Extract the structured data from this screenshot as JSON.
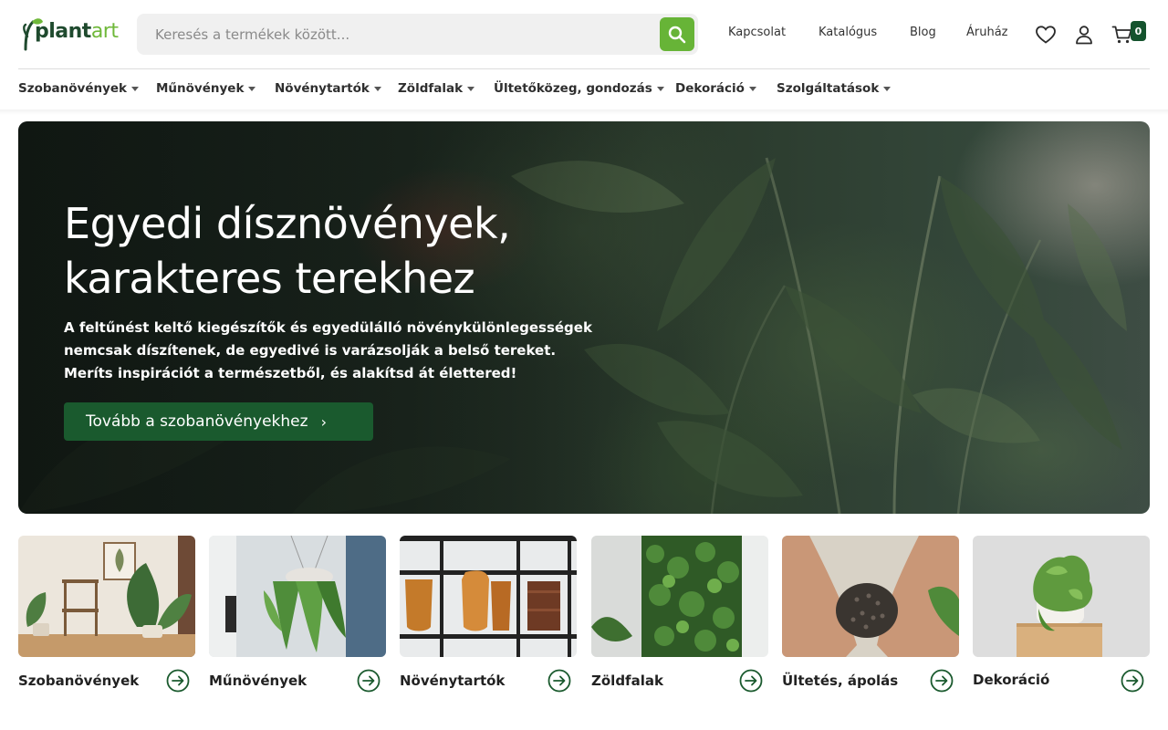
{
  "brand": {
    "logo_first": "plant",
    "logo_second": "art",
    "green": "#67b437",
    "dark_green": "#1a5a2e"
  },
  "search": {
    "placeholder": "Keresés a termékek között...",
    "value": ""
  },
  "header_links": [
    "Kapcsolat",
    "Katalógus",
    "Blog",
    "Áruház"
  ],
  "header_icons": {
    "wishlist": "heart-icon",
    "account": "user-icon",
    "cart": "cart-icon"
  },
  "cart": {
    "count": "0"
  },
  "category_nav": [
    "Szobanövények",
    "Műnövények",
    "Növénytartók",
    "Zöldfalak",
    "Ültetőközeg, gondozás",
    "Dekoráció",
    "Szolgáltatások"
  ],
  "hero": {
    "title_line1": "Egyedi dísznövények,",
    "title_line2": "karakteres terekhez",
    "text_line1": "A feltűnést keltő kiegészítők és egyedülálló növénykülönlegességek",
    "text_line2": "nemcsak díszítenek, de egyedivé is varázsolják a belső tereket.",
    "text_line3": "Meríts inspirációt a természetből, és alakítsd át élettered!",
    "cta": "Tovább a szobanövényekhez"
  },
  "cards": [
    {
      "label": "Szobanövények"
    },
    {
      "label": "Műnövények"
    },
    {
      "label": "Növénytartók"
    },
    {
      "label": "Zöldfalak"
    },
    {
      "label": "Ültetés, ápolás"
    },
    {
      "label": "Dekoráció"
    }
  ]
}
